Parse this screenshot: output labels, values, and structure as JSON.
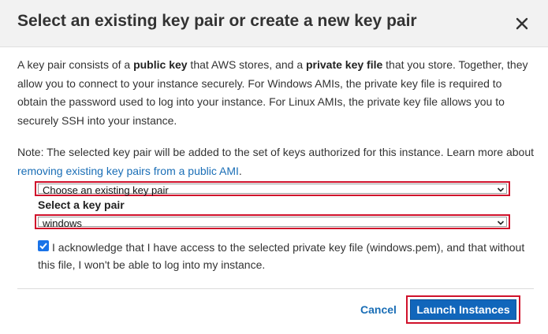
{
  "dialog": {
    "title": "Select an existing key pair or create a new key pair"
  },
  "description": {
    "part1": "A key pair consists of a ",
    "bold1": "public key",
    "part2": " that AWS stores, and a ",
    "bold2": "private key file",
    "part3": " that you store. Together, they allow you to connect to your instance securely. For Windows AMIs, the private key file is required to obtain the password used to log into your instance. For Linux AMIs, the private key file allows you to securely SSH into your instance."
  },
  "note": {
    "text": "Note: The selected key pair will be added to the set of keys authorized for this instance. Learn more about ",
    "link": "removing existing key pairs from a public AMI",
    "after": "."
  },
  "key_pair_mode": {
    "selected": "Choose an existing key pair"
  },
  "key_pair": {
    "label": "Select a key pair",
    "selected": "windows"
  },
  "acknowledge": {
    "checked": true,
    "text": "I acknowledge that I have access to the selected private key file (windows.pem), and that without this file, I won't be able to log into my instance."
  },
  "footer": {
    "cancel": "Cancel",
    "launch": "Launch Instances"
  },
  "colors": {
    "accent": "#1166bb",
    "highlight_border": "#d0112b",
    "link": "#1a6eb6"
  },
  "icons": {
    "close": "close-icon",
    "dropdown": "chevron-down-icon",
    "checkbox": "checkmark-icon"
  }
}
